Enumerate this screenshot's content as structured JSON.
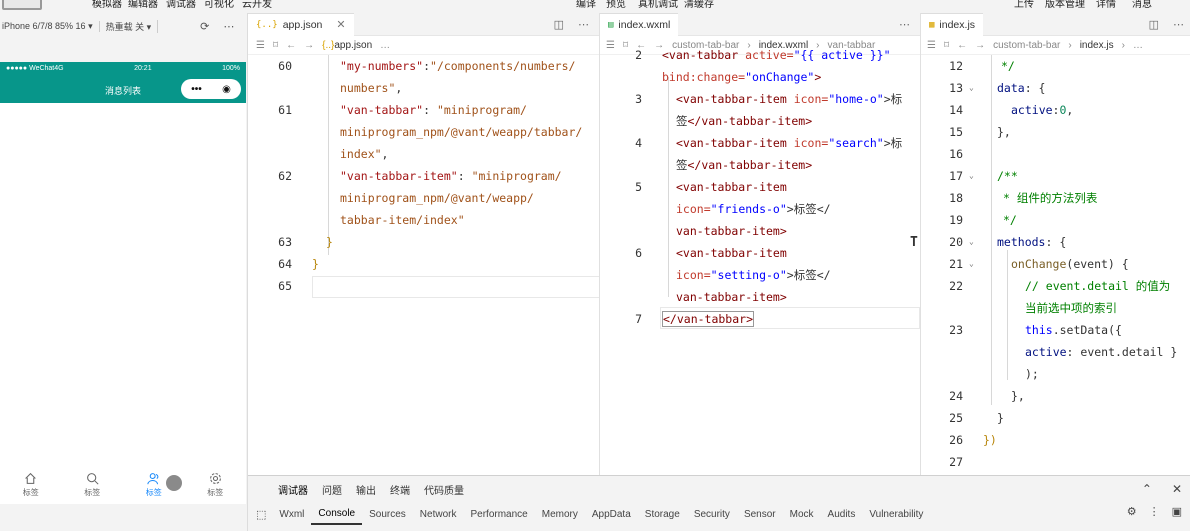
{
  "menu": [
    "模拟器",
    "编辑器",
    "调试器",
    "可视化",
    "云开发"
  ],
  "menu_right_center": [
    "编译",
    "预览",
    "真机调试",
    "清缓存"
  ],
  "menu_right": [
    "上传",
    "版本管理",
    "详情",
    "消息"
  ],
  "simulator": {
    "device_select": "iPhone 6/7/8 85% 16 ▾",
    "hot_reload": "热重载 关 ▾",
    "carrier": "●●●●● WeChat4G",
    "time": "20:21",
    "battery": "100%",
    "page_title": "消息列表",
    "capsule_dots": "•••",
    "capsule_target": "◉",
    "tabs": [
      {
        "label": "标签",
        "icon": "home-icon",
        "active": false
      },
      {
        "label": "标签",
        "icon": "search-icon",
        "active": false
      },
      {
        "label": "标签",
        "icon": "friends-icon",
        "active": true
      },
      {
        "label": "标签",
        "icon": "setting-icon",
        "active": false
      }
    ]
  },
  "pane1": {
    "tab_label": "app.json",
    "tab_icon": "{..}",
    "crumb_file": "app.json",
    "crumb_more": "…",
    "line_numbers": [
      "60",
      "61",
      "62",
      "63",
      "64",
      "65"
    ],
    "lines": [
      [
        "\"my-numbers\"",
        ":",
        "\"/components/numbers/"
      ],
      [
        "numbers\"",
        ","
      ],
      [
        "\"van-tabbar\"",
        ": ",
        "\"miniprogram/"
      ],
      [
        "miniprogram_npm/@vant/weapp/tabbar/"
      ],
      [
        "index\"",
        ","
      ],
      [
        "\"van-tabbar-item\"",
        ": ",
        "\"miniprogram/"
      ],
      [
        "miniprogram_npm/@vant/weapp/"
      ],
      [
        "tabbar-item/index\""
      ],
      [
        "}"
      ],
      [
        "}"
      ]
    ]
  },
  "pane2": {
    "tab_label": "index.wxml",
    "crumbs": [
      "custom-tab-bar",
      "index.wxml",
      "van-tabbar"
    ],
    "line_numbers": [
      "2",
      "3",
      "4",
      "5",
      "6",
      "7"
    ],
    "l2a_tag": "<van-tabbar",
    "l2a_attr": " active=",
    "l2a_val": "\"{{ active }}\"",
    "l2b_attr": "bind:change=",
    "l2b_val": "\"onChange\"",
    "l2b_end": ">",
    "l3a_tag": "<van-tabbar-item",
    "l3a_attr": " icon=",
    "l3a_val": "\"home-o\"",
    "l3a_text": ">标",
    "l3b_text": "签",
    "l3b_tag": "</van-tabbar-item>",
    "l4a_tag": "<van-tabbar-item",
    "l4a_attr": " icon=",
    "l4a_val": "\"search\"",
    "l4a_text": ">标",
    "l4b_text": "签",
    "l4b_tag": "</van-tabbar-item>",
    "l5a_tag": "<van-tabbar-item",
    "l5b_attr": "icon=",
    "l5b_val": "\"friends-o\"",
    "l5b_text": ">标签</",
    "l5c_tag": "van-tabbar-item>",
    "l6a_tag": "<van-tabbar-item",
    "l6b_attr": "icon=",
    "l6b_val": "\"setting-o\"",
    "l6b_text": ">标签</",
    "l6c_tag": "van-tabbar-item>",
    "l7_tag": "</van-tabbar>"
  },
  "pane3": {
    "tab_label": "index.js",
    "crumbs": [
      "custom-tab-bar",
      "index.js",
      "…"
    ],
    "line_numbers": [
      "12",
      "13",
      "14",
      "15",
      "16",
      "17",
      "18",
      "19",
      "20",
      "21",
      "22",
      "23",
      "24",
      "25",
      "26",
      "27"
    ],
    "l12": "*/",
    "l13a": "data",
    "l13b": ": {",
    "l14a": "active",
    "l14b": ":",
    "l14c": "0",
    "l14d": ",",
    "l15": "},",
    "l17": "/**",
    "l18": "* 组件的方法列表",
    "l19": "*/",
    "l20a": "methods",
    "l20b": ": {",
    "l21a": "onChange",
    "l21b": "(event) {",
    "l22a": "// event.detail 的值为",
    "l22b": "当前选中项的索引",
    "l23a": "this",
    "l23b": ".setData({",
    "l23c": "active",
    "l23d": ": event.detail }",
    "l23e": ");",
    "l24": "},",
    "l25": "}",
    "l26": "})"
  },
  "debugger": {
    "top_tabs": [
      "调试器",
      "问题",
      "输出",
      "终端",
      "代码质量"
    ],
    "tabs": [
      "Wxml",
      "Console",
      "Sources",
      "Network",
      "Performance",
      "Memory",
      "AppData",
      "Storage",
      "Security",
      "Sensor",
      "Mock",
      "Audits",
      "Vulnerability"
    ],
    "active_tab": "Console"
  }
}
